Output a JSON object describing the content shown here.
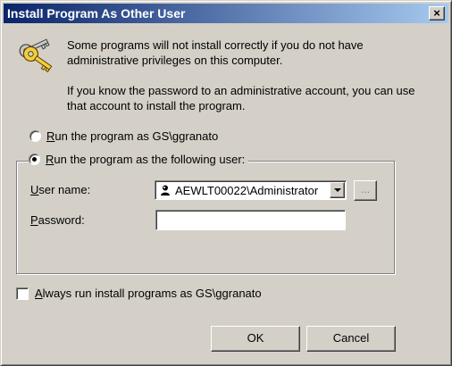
{
  "window": {
    "title": "Install Program As Other User",
    "close_label": "×"
  },
  "intro": {
    "paragraph1": "Some programs will not install correctly if you do not have administrative privileges on this computer.",
    "paragraph2": "If you know the password to an administrative account, you can use that account to install the program."
  },
  "options": {
    "current_user": {
      "accel": "R",
      "rest": "un the program as GS\\ggranato",
      "checked": false
    },
    "other_user": {
      "accel": "R",
      "rest": "un the program as the following user:",
      "checked": true
    }
  },
  "form": {
    "username_accel": "U",
    "username_rest": "ser name:",
    "username_value": "AEWLT00022\\Administrator",
    "user_icon": "user-account-icon",
    "browse_label": "...",
    "password_accel": "P",
    "password_rest": "assword:",
    "password_value": ""
  },
  "always": {
    "accel": "A",
    "rest": "lways run install programs as GS\\ggranato",
    "checked": false
  },
  "buttons": {
    "ok": "OK",
    "cancel": "Cancel"
  },
  "colors": {
    "face": "#d4d0c8",
    "title_start": "#0a246a",
    "title_end": "#a6caf0"
  },
  "icons": {
    "header": "keys-icon"
  }
}
